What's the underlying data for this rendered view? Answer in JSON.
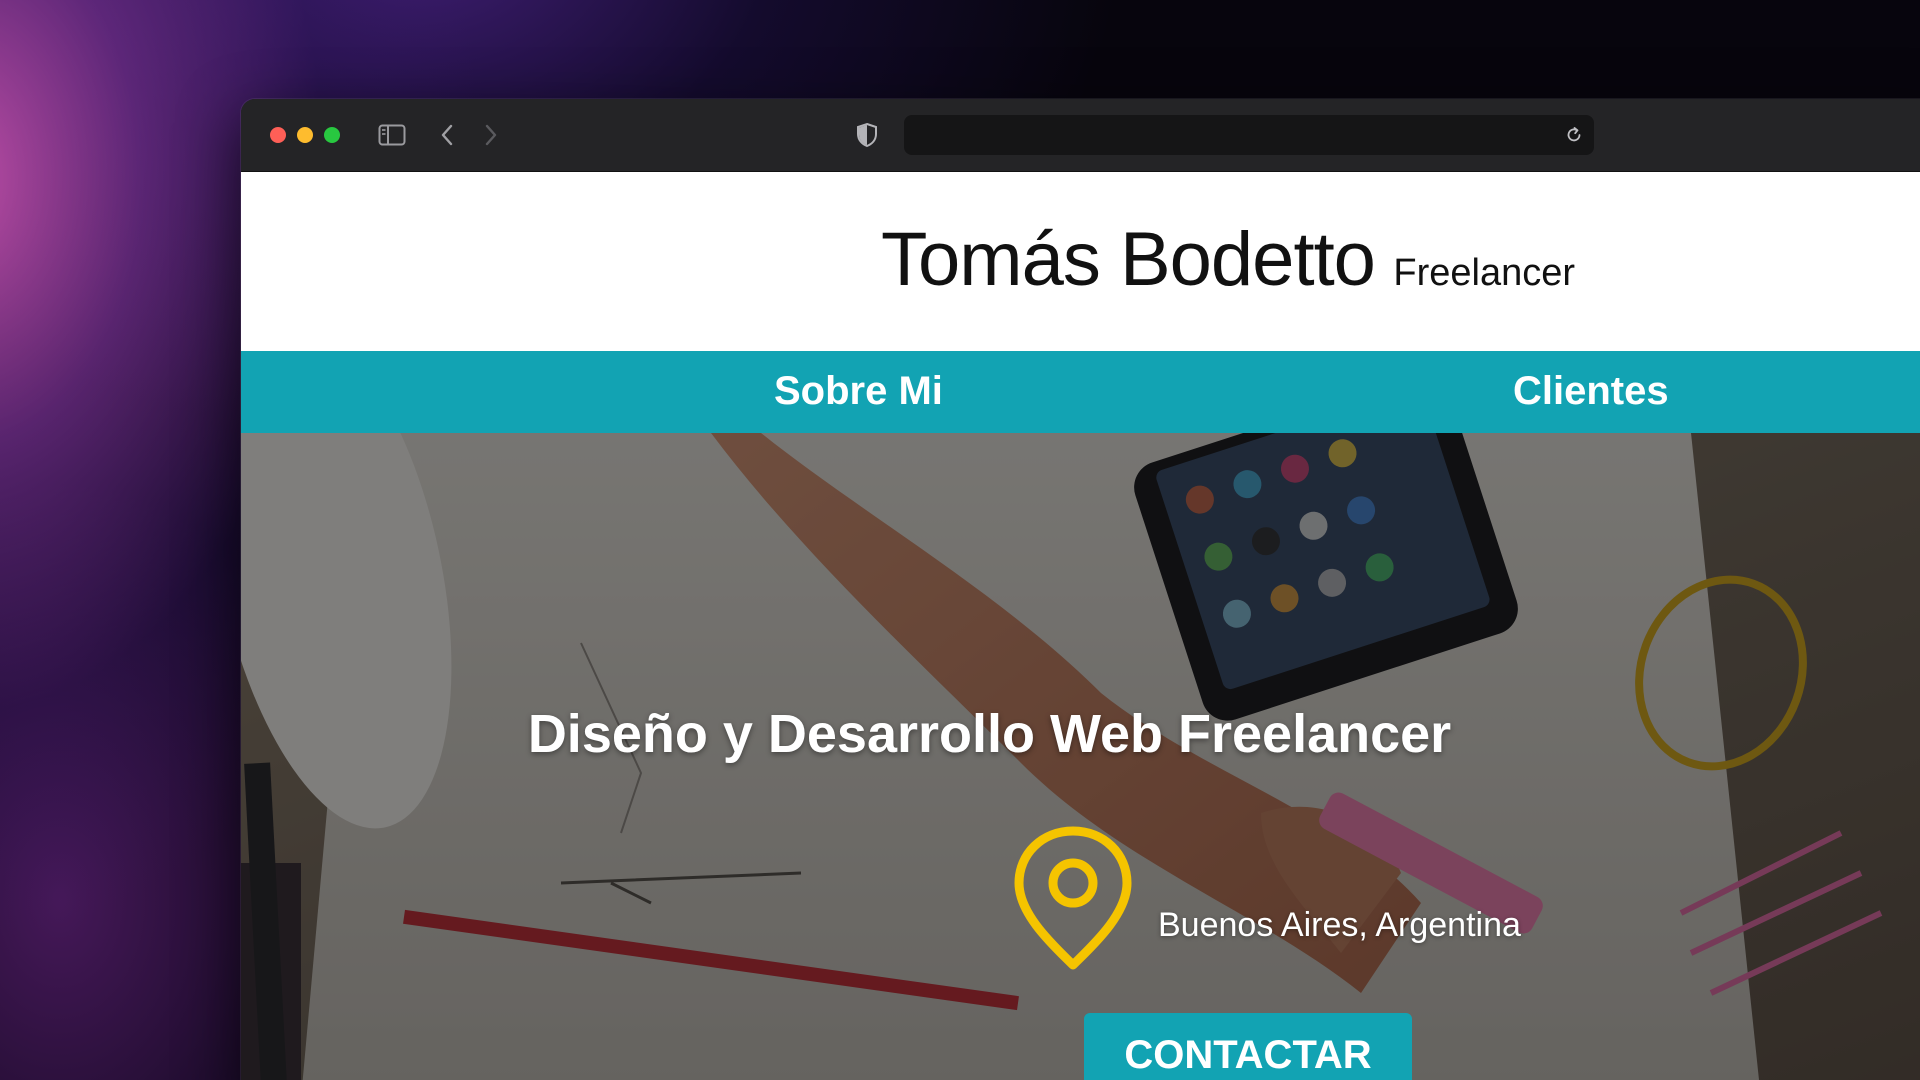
{
  "browser": {
    "url": "",
    "icons": {
      "sidebar": "sidebar-icon",
      "back": "chevron-left-icon",
      "forward": "chevron-right-icon",
      "privacy": "shield-icon",
      "reload": "reload-icon"
    }
  },
  "header": {
    "name": "Tomás Bodetto",
    "tagline": "Freelancer"
  },
  "nav": {
    "items": [
      {
        "label": "Sobre Mi"
      },
      {
        "label": "Clientes"
      }
    ]
  },
  "hero": {
    "title": "Diseño y Desarrollo Web Freelancer",
    "location": "Buenos Aires, Argentina",
    "location_icon": "map-pin-icon",
    "cta_label": "CONTACTAR"
  },
  "colors": {
    "accent": "#12a3b3",
    "pin": "#f5c400",
    "header_bg": "#ffffff"
  }
}
